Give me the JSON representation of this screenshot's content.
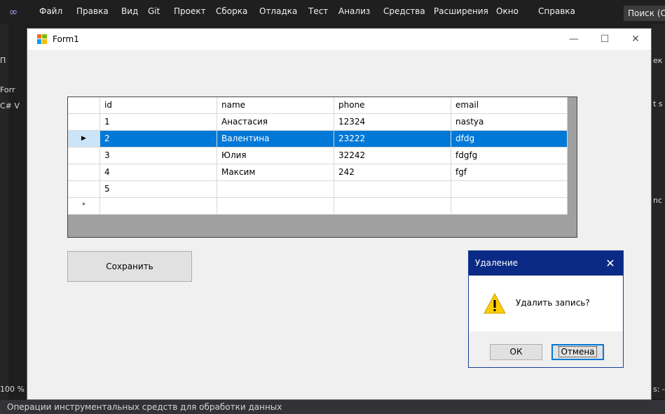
{
  "vs": {
    "menu": [
      "Файл",
      "Правка",
      "Вид",
      "Git",
      "Проект",
      "Сборка",
      "Отладка",
      "Тест",
      "Анализ",
      "Средства",
      "Расширения",
      "Окно",
      "Справка"
    ],
    "search_label": "Поиск (C",
    "left_fragments": [
      "П",
      "Forr",
      "C# V",
      "100 %"
    ],
    "right_fragments": [
      "ек",
      "t s",
      "nc",
      "s: -"
    ],
    "status_text": "Операции инструментальных средств для обработки данных"
  },
  "form": {
    "title": "Form1",
    "minimize_glyph": "—",
    "maximize_glyph": "☐",
    "close_glyph": "✕",
    "grid": {
      "columns": [
        "id",
        "name",
        "phone",
        "email"
      ],
      "rows": [
        {
          "marker": "",
          "id": "1",
          "name": "Анастасия",
          "phone": "12324",
          "email": "nastya"
        },
        {
          "marker": "▶",
          "id": "2",
          "name": "Валентина",
          "phone": "23222",
          "email": "dfdg",
          "selected": true
        },
        {
          "marker": "",
          "id": "3",
          "name": "Юлия",
          "phone": "32242",
          "email": "fdgfg"
        },
        {
          "marker": "",
          "id": "4",
          "name": "Максим",
          "phone": "242",
          "email": "fgf"
        },
        {
          "marker": "",
          "id": "5",
          "name": "",
          "phone": "",
          "email": ""
        },
        {
          "marker": "*",
          "id": "",
          "name": "",
          "phone": "",
          "email": ""
        }
      ]
    },
    "save_label": "Сохранить"
  },
  "dialog": {
    "title": "Удаление",
    "close_glyph": "✕",
    "message": "Удалить запись?",
    "ok_label": "ОК",
    "cancel_label": "Отмена",
    "icon": "warning-icon"
  },
  "colors": {
    "selection": "#0078d7",
    "dialog_title": "#0a2a86"
  }
}
